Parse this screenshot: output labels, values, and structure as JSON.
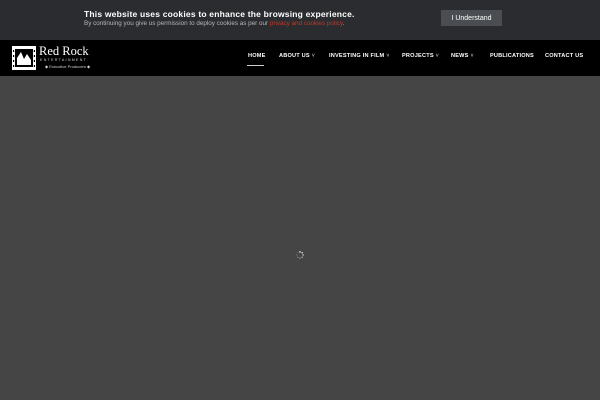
{
  "cookie_banner": {
    "title": "This website uses cookies to enhance the browsing experience.",
    "text": "By continuing you give us permission to deploy cookies as per our ",
    "link_text": "privacy and cookies policy",
    "suffix": ".",
    "button_label": "I Understand"
  },
  "logo": {
    "name": "Red Rock",
    "subtitle": "ENTERTAINMENT",
    "tagline": "◆ Executive Producers ◆"
  },
  "nav": {
    "items": [
      {
        "label": "HOME",
        "has_dropdown": false,
        "active": true
      },
      {
        "label": "ABOUT US",
        "has_dropdown": true
      },
      {
        "label": "INVESTING IN FILM",
        "has_dropdown": true
      },
      {
        "label": "PROJECTS",
        "has_dropdown": true
      },
      {
        "label": "NEWS",
        "has_dropdown": true
      },
      {
        "label": "PUBLICATIONS",
        "has_dropdown": false
      },
      {
        "label": "CONTACT US",
        "has_dropdown": false
      }
    ],
    "dropdown_glyph": "˅"
  },
  "colors": {
    "page_bg": "#454545",
    "banner_bg": "#2a2c2f",
    "header_bg": "#000000",
    "link_accent": "#c0392b"
  },
  "icons": {
    "logo": "film-clapper-icon",
    "loader": "spinner-icon",
    "dropdown": "chevron-down-icon"
  }
}
